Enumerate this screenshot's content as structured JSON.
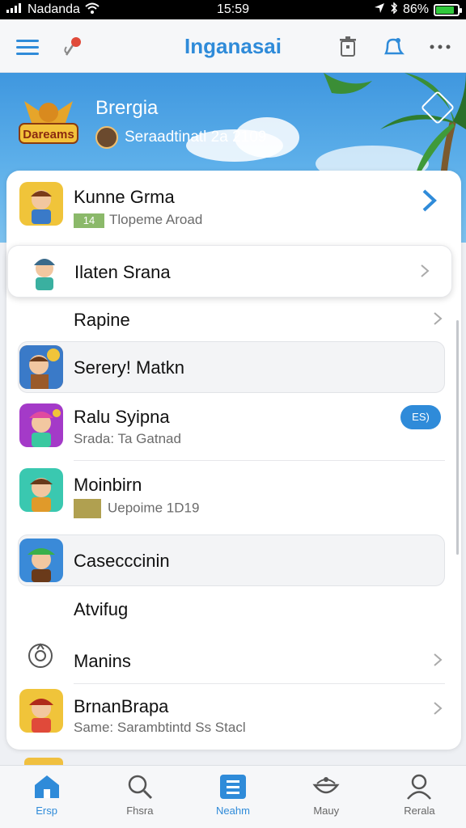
{
  "status": {
    "carrier": "Nadanda",
    "time": "15:59",
    "battery": "86%",
    "battery_level": 0.86
  },
  "app_bar": {
    "title": "Inganasai"
  },
  "banner": {
    "logo_text": "Dareams",
    "name": "Brergia",
    "subtitle": "Seraadtinatl 2a 2109"
  },
  "list": {
    "items": [
      {
        "label": "Kunne Grma",
        "tag": "14",
        "sub": "Tlopeme Aroad"
      },
      {
        "label": "Ilaten Srana"
      },
      {
        "label": "Rapine"
      },
      {
        "label": "Serery! Matkn"
      },
      {
        "label": "Ralu Syipna",
        "sub": "Srada: Ta Gatnad",
        "badge": "ES)"
      },
      {
        "label": "Moinbirn",
        "sub": "Uepoime 1D19"
      },
      {
        "label": "Casecccinin"
      },
      {
        "label": "Atvifug"
      },
      {
        "label": "Manins"
      },
      {
        "label": "BrnanBrapa",
        "sub": "Same: Sarambtintd Ss Stacl"
      }
    ]
  },
  "nav": {
    "items": [
      {
        "label": "Ersp",
        "icon": "home-icon"
      },
      {
        "label": "Fhsra",
        "icon": "search-icon"
      },
      {
        "label": "Neahm",
        "icon": "news-icon"
      },
      {
        "label": "Mauy",
        "icon": "bowl-icon"
      },
      {
        "label": "Rerala",
        "icon": "person-icon"
      }
    ]
  },
  "colors": {
    "accent": "#2f8bd9",
    "status_bar": "#000000",
    "battery": "#31c93c"
  }
}
